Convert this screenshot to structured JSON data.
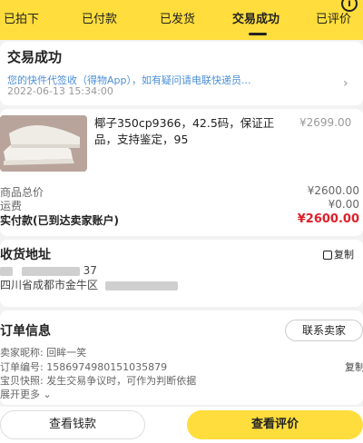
{
  "tabs": [
    {
      "label": "已拍下"
    },
    {
      "label": "已付款"
    },
    {
      "label": "已发货"
    },
    {
      "label": "交易成功"
    },
    {
      "label": "已评价"
    }
  ],
  "active_tab_index": 3,
  "status": {
    "title": "交易成功",
    "desc": "您的快件代签收（得物App），如有疑问请电联快递员...",
    "time": "2022-06-13 15:34:00"
  },
  "product": {
    "name": "椰子350cp9366，42.5码，保证正品，支持鉴定，95",
    "price": "¥2699.00"
  },
  "amounts": {
    "goods_total_label": "商品总价",
    "goods_total_value": "¥2600.00",
    "shipping_label": "运费",
    "shipping_value": "¥0.00",
    "paid_label": "实付款(已到达卖家账户)",
    "paid_value": "¥2600.00"
  },
  "address": {
    "title": "收货地址",
    "copy_label": "复制",
    "phone_tail": "37",
    "line2": "四川省成都市金牛区"
  },
  "order": {
    "title": "订单信息",
    "contact_label": "联系卖家",
    "seller_line": "卖家昵称: 回眸一笑",
    "number_line": "订单编号: 1586974980151035879",
    "copy_label": "复制",
    "snapshot_line": "宝贝快照: 发生交易争议时，可作为判断依据",
    "expand_label": "展开更多"
  },
  "actions": {
    "view_money": "查看钱款",
    "view_review": "查看评价"
  },
  "colors": {
    "brand_yellow": "#ffdd3c",
    "price_red": "#e0202a",
    "link_blue": "#4a8fd8"
  }
}
